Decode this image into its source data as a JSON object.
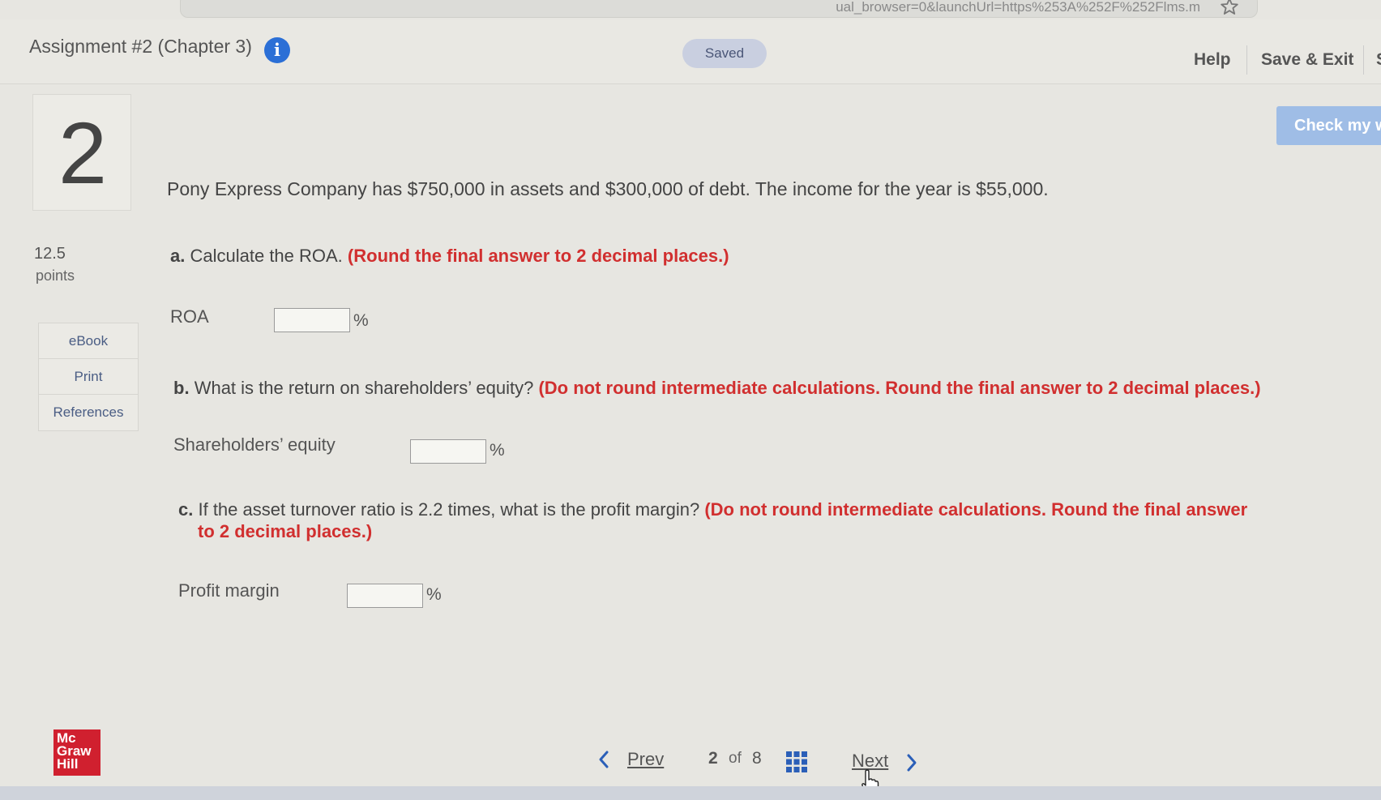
{
  "browser": {
    "url_fragment": "ual_browser=0&launchUrl=https%253A%252F%252Flms.m"
  },
  "header": {
    "title": "Assignment #2 (Chapter 3)",
    "info_glyph": "i",
    "saved_label": "Saved",
    "help_label": "Help",
    "save_exit_label": "Save & Exit",
    "submit_label": "S"
  },
  "sidebar": {
    "question_number": "2",
    "points_value": "12.5",
    "points_label": "points",
    "links": [
      "eBook",
      "Print",
      "References"
    ]
  },
  "check_button_label": "Check my w",
  "question": {
    "stem": "Pony Express Company has $750,000 in assets and $300,000 of debt. The income for the year is $55,000.",
    "parts": [
      {
        "letter": "a.",
        "text": "Calculate the ROA.",
        "instruction": "(Round the final answer to 2 decimal places.)",
        "field_label": "ROA",
        "value": "",
        "unit": "%"
      },
      {
        "letter": "b.",
        "text": "What is the return on shareholders’ equity?",
        "instruction": "(Do not round intermediate calculations. Round the final answer to 2 decimal places.)",
        "field_label": "Shareholders’ equity",
        "value": "",
        "unit": "%"
      },
      {
        "letter": "c.",
        "text": "If the asset turnover ratio is 2.2 times, what is the profit margin?",
        "instruction": "(Do not round intermediate calculations. Round the final answer",
        "instruction_cont": "to 2 decimal places.)",
        "field_label": "Profit margin",
        "value": "",
        "unit": "%"
      }
    ]
  },
  "footer": {
    "logo_lines": [
      "Mc",
      "Graw",
      "Hill"
    ],
    "prev_label": "Prev",
    "current_page": "2",
    "of_label": "of",
    "total_pages": "8",
    "next_label": "Next"
  },
  "colors": {
    "warning_red": "#d12f2f",
    "link_blue": "#4a5d84",
    "info_blue": "#2b6fd6",
    "check_button": "#9fbde6",
    "brand_red": "#d0202f"
  },
  "icons": [
    "star-icon",
    "info-icon",
    "chevron-left-icon",
    "grid-icon",
    "chevron-right-icon",
    "hand-cursor-icon"
  ]
}
